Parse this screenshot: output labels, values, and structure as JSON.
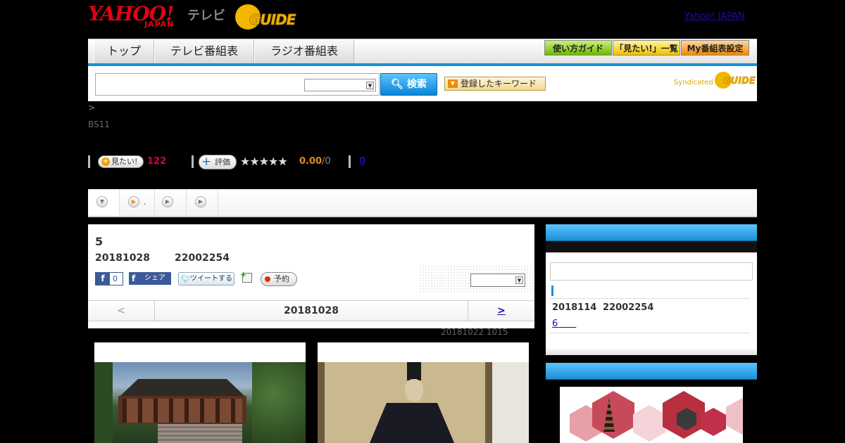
{
  "header": {
    "yahoo_logo": "YAHOO!",
    "japan_label": "JAPAN",
    "tv_label": "テレビ",
    "gguide_logo": "GUIDE",
    "yahoo_japan_link": "Yahoo! JAPAN"
  },
  "nav": {
    "tabs": [
      {
        "label": "トップ"
      },
      {
        "label": "テレビ番組表"
      },
      {
        "label": "ラジオ番組表"
      }
    ],
    "guide_btn": "使い方ガイド",
    "mitai_list_btn": "「見たい!」一覧",
    "my_schedule_btn": "My番組表設定"
  },
  "search": {
    "input_value": "",
    "select_value": "",
    "search_btn": "検索",
    "keyword_btn": "登録したキーワード",
    "syndicated": "Syndicated",
    "syndicated_logo": "GUIDE"
  },
  "breadcrumb": ">",
  "channel": "BS11",
  "ratings": {
    "mitai_btn": "見たい!",
    "mitai_count": "122",
    "hyoka_btn": "評価",
    "stars": "★★★★★",
    "score": "0.00",
    "score_den": "/0",
    "review_count": "0"
  },
  "tabs": [
    {
      "label": ""
    },
    {
      "label": "."
    },
    {
      "label": ""
    },
    {
      "label": ""
    }
  ],
  "episode": {
    "title": "5",
    "date": "20181028",
    "time": "22002254",
    "fb_like_count": "0",
    "fb_share": "シェア",
    "tweet_btn": "ツイートする",
    "yoyaku_btn": "予約",
    "select_value": "",
    "prev": "<",
    "nav_date": "20181028",
    "next": ">",
    "updated": "20181022  1015"
  },
  "sidebar": {
    "search_value": "",
    "next_date": "2018114",
    "next_time": "22002254",
    "next_link": "6　　"
  },
  "colors": {
    "accent_blue": "#1a8fd6",
    "yahoo_red": "#e60012",
    "gguide_yellow": "#f2b600",
    "mitai_pink": "#e0004a",
    "score_orange": "#e08a20"
  }
}
